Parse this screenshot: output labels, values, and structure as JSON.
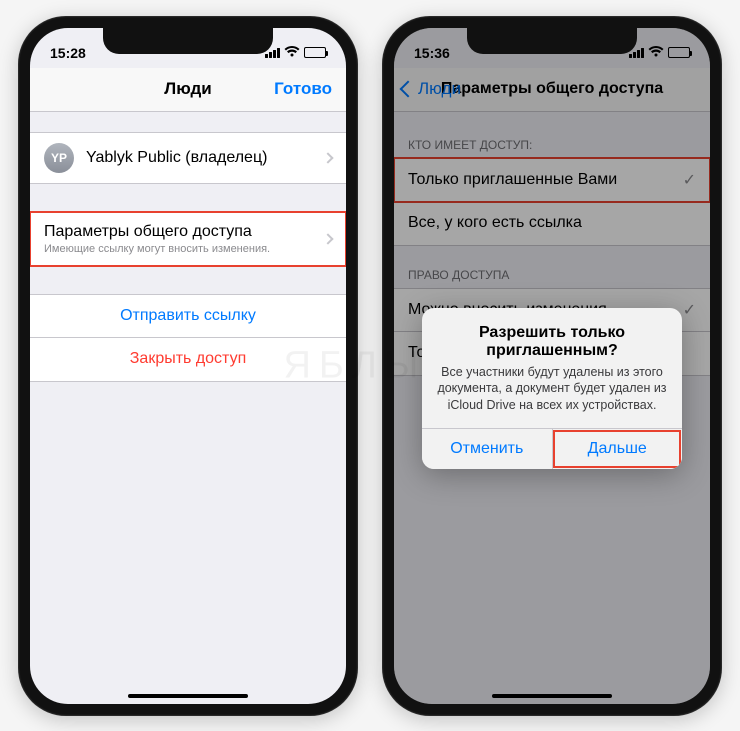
{
  "watermark": "ЯБЛЫК",
  "left": {
    "status": {
      "time": "15:28"
    },
    "nav": {
      "title": "Люди",
      "done": "Готово"
    },
    "owner": {
      "initials": "YP",
      "name": "Yablyk Public (владелец)"
    },
    "sharing": {
      "title": "Параметры общего доступа",
      "subtitle": "Имеющие ссылку могут вносить изменения."
    },
    "send_link": "Отправить ссылку",
    "close_access": "Закрыть доступ"
  },
  "right": {
    "status": {
      "time": "15:36"
    },
    "nav": {
      "back": "Люди",
      "title": "Параметры общего доступа"
    },
    "sections": {
      "who_header": "КТО ИМЕЕТ ДОСТУП:",
      "only_invited": "Только приглашенные Вами",
      "anyone_link": "Все, у кого есть ссылка",
      "perm_header": "ПРАВО ДОСТУПА",
      "can_edit": "Можно вносить изменения",
      "view_only": "Только просмотр"
    },
    "alert": {
      "title": "Разрешить только приглашенным?",
      "message": "Все участники будут удалены из этого документа, а документ будет удален из iCloud Drive на всех их устройствах.",
      "cancel": "Отменить",
      "confirm": "Дальше"
    }
  }
}
